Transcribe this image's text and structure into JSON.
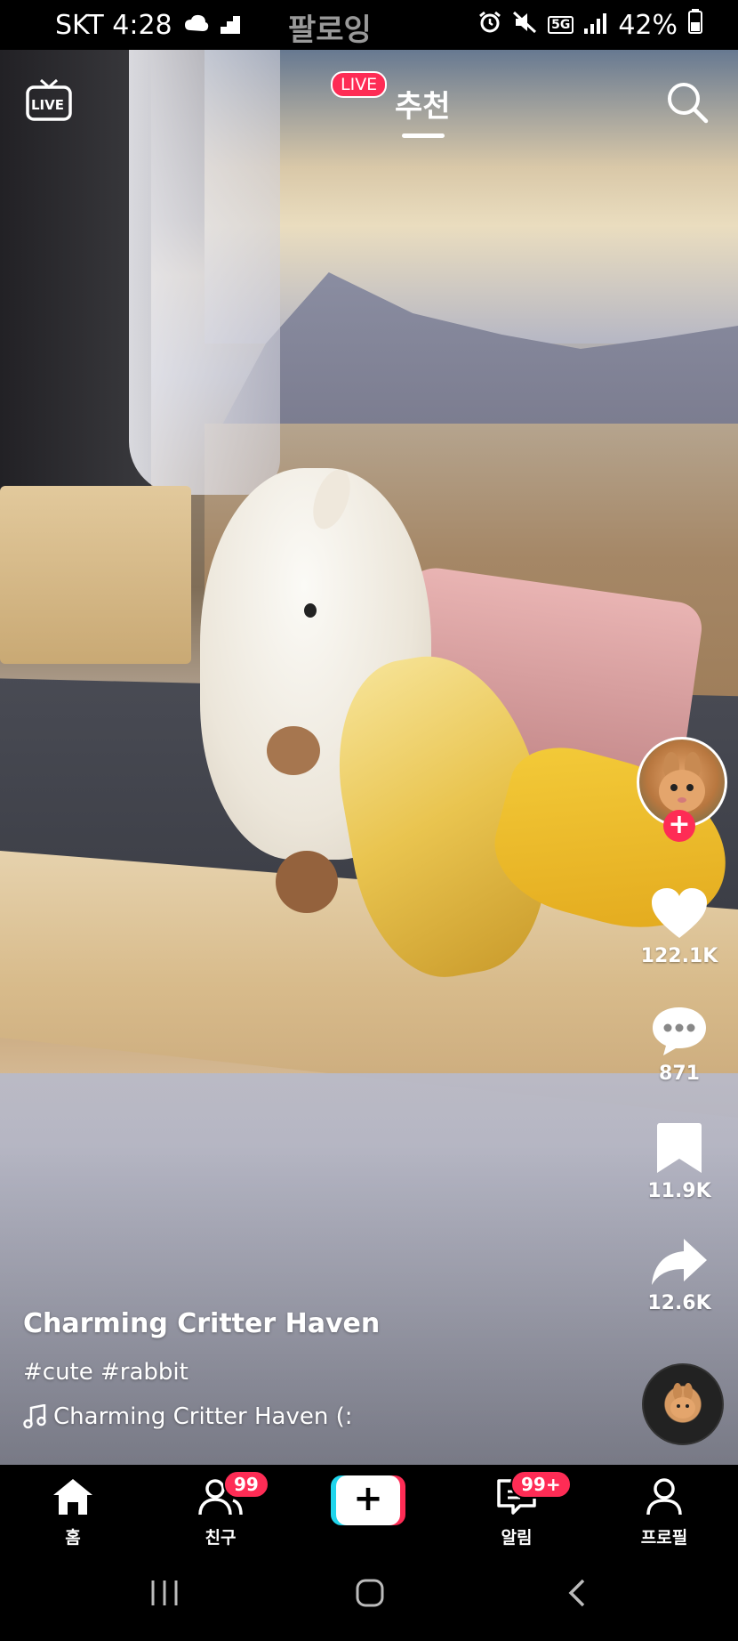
{
  "status_bar": {
    "carrier_time": "SKT 4:28",
    "network": "5G",
    "battery": "42%"
  },
  "top": {
    "live_icon_text": "LIVE",
    "tabs": [
      {
        "label": "팔로잉",
        "active": false
      },
      {
        "label": "추천",
        "active": true
      }
    ],
    "live_badge": "LIVE"
  },
  "post": {
    "author": "Charming Critter Haven",
    "hashtags": "#cute #rabbit",
    "sound": "Charming Critter Haven (:"
  },
  "actions": {
    "likes": "122.1K",
    "comments": "871",
    "saves": "11.9K",
    "shares": "12.6K"
  },
  "bottom_nav": {
    "items": [
      {
        "label": "홈",
        "icon": "home-icon"
      },
      {
        "label": "친구",
        "icon": "friends-icon",
        "badge": "99"
      },
      {
        "label": "",
        "icon": "create-icon"
      },
      {
        "label": "알림",
        "icon": "inbox-icon",
        "badge": "99+"
      },
      {
        "label": "프로필",
        "icon": "profile-icon"
      }
    ]
  },
  "colors": {
    "accent": "#fe2c55",
    "cyan": "#20d5ec"
  }
}
